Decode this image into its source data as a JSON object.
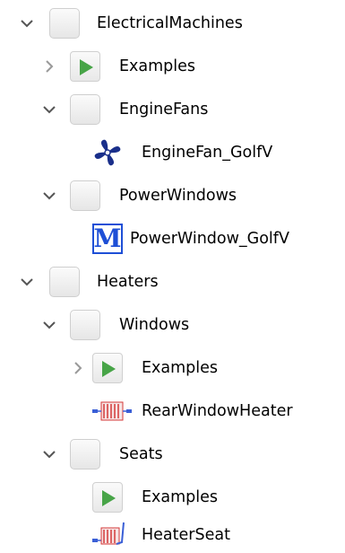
{
  "tree": {
    "items": [
      {
        "label": "ElectricalMachines",
        "icon": "package-icon",
        "expanded": true
      },
      {
        "label": "Examples",
        "icon": "examples-play-icon",
        "expanded": false
      },
      {
        "label": "EngineFans",
        "icon": "package-icon",
        "expanded": true
      },
      {
        "label": "EngineFan_GolfV",
        "icon": "fan-icon"
      },
      {
        "label": "PowerWindows",
        "icon": "package-icon",
        "expanded": true
      },
      {
        "label": "PowerWindow_GolfV",
        "icon": "modelica-m-icon",
        "icon_text": "M"
      },
      {
        "label": "Heaters",
        "icon": "package-icon",
        "expanded": true
      },
      {
        "label": "Windows",
        "icon": "package-icon",
        "expanded": true
      },
      {
        "label": "Examples",
        "icon": "examples-play-icon",
        "expanded": false
      },
      {
        "label": "RearWindowHeater",
        "icon": "heater-icon"
      },
      {
        "label": "Seats",
        "icon": "package-icon",
        "expanded": true
      },
      {
        "label": "Examples",
        "icon": "examples-play-icon"
      },
      {
        "label": "HeaterSeat",
        "icon": "heater-seat-icon"
      }
    ]
  },
  "colors": {
    "toggle": "#555555",
    "play": "#47a447",
    "modelica_blue": "#1e4fd6",
    "fan_blue": "#1a2f8a",
    "heater_red": "#d43a3a"
  }
}
